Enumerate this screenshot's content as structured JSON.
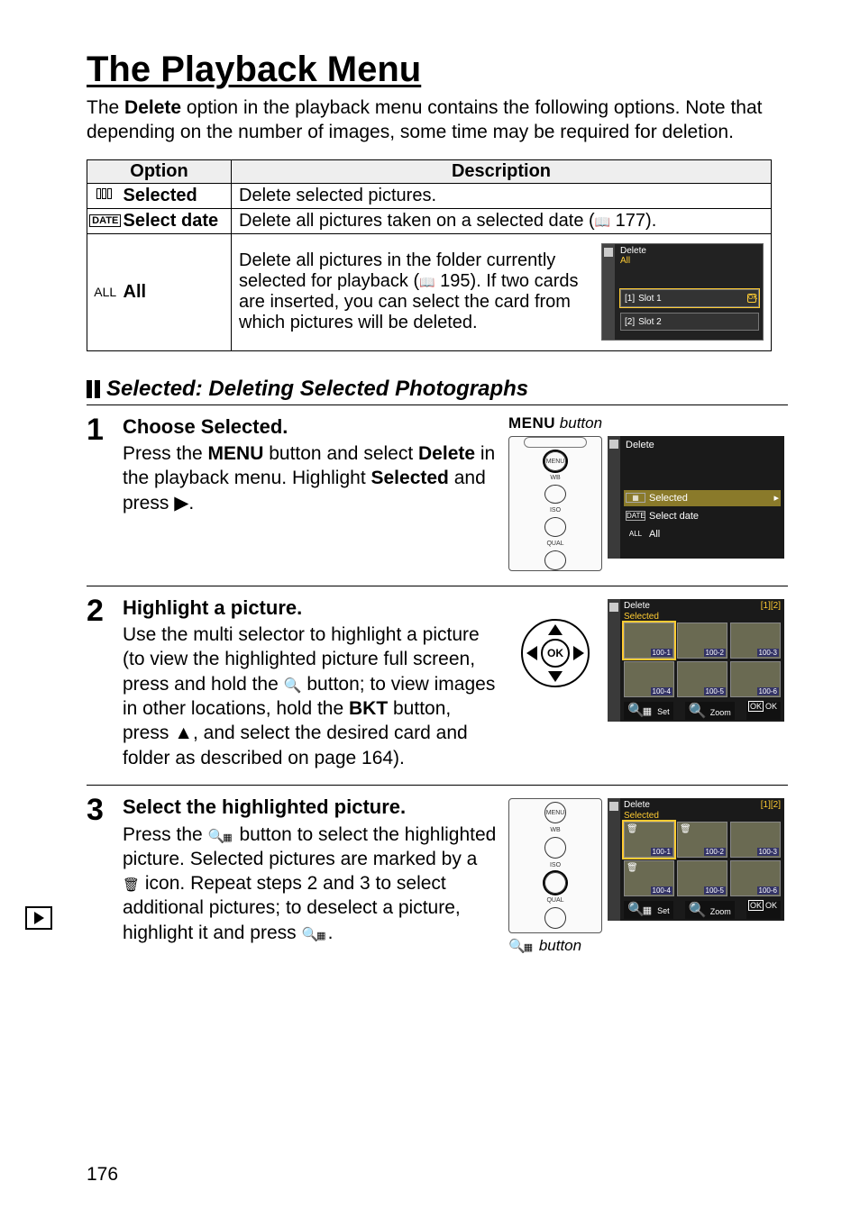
{
  "title": "The Playback Menu",
  "intro_a": "The ",
  "intro_b": "Delete",
  "intro_c": " option in the playback menu contains the following options.  Note that depending on the number of images, some time may be required for deletion.",
  "table": {
    "h_option": "Option",
    "h_desc": "Description",
    "r1_opt": "Selected",
    "r1_desc": "Delete selected pictures.",
    "r2_opt": "Select date",
    "r2_desc_a": "Delete all pictures taken on a selected date (",
    "r2_desc_b": " 177).",
    "r3_icon": "ALL",
    "r3_opt": "All",
    "r3_desc_a": "Delete all pictures in the folder currently selected for playback (",
    "r3_desc_b": " 195). If two cards are inserted, you can select the card from which pictures will be deleted.",
    "date_badge": "DATE"
  },
  "mini": {
    "title": "Delete",
    "sub": "All",
    "slot1": "Slot 1",
    "slot2": "Slot 2",
    "ok": "OK",
    "slot1_ic": "[1]",
    "slot2_ic": "[2]"
  },
  "section": "Selected: Deleting Selected Photographs",
  "step1": {
    "head": "Choose Selected.",
    "a": "Press the ",
    "menu": "MENU",
    "b": " button and select ",
    "del": "Delete",
    "c": " in the playback menu.  Highlight ",
    "sel": "Selected",
    "d": " and press ",
    "tri": "▶",
    "e": ".",
    "cap_a": "MENU",
    "cap_b": " button"
  },
  "menu_shot": {
    "title": "Delete",
    "r1": "Selected",
    "r2": "Select date",
    "r3": "All",
    "r1_ic": "▦",
    "r2_ic": "DATE",
    "r3_ic": "ALL",
    "arr": "▸"
  },
  "step2": {
    "head": "Highlight a picture.",
    "body_a": "Use the multi selector to highlight a picture (to view the highlighted picture full screen, press and hold the ",
    "body_b": " button; to view images in other locations, hold the ",
    "bkt": "BKT",
    "body_c": " button, press ",
    "tri_up": "▲",
    "body_d": ", and select the desired card and folder as described on page 164).",
    "ok": "OK"
  },
  "step3": {
    "head": "Select the highlighted picture.",
    "a": "Press the ",
    "b": " button to select the highlighted picture.  Selected pictures are marked by a ",
    "c": " icon.  Repeat steps 2 and 3 to select additional pictures; to deselect a picture, highlight it and press ",
    "d": ".",
    "cap": " button"
  },
  "thumb": {
    "title": "Delete",
    "sub": "Selected",
    "badge": "[1][2]",
    "cells": [
      "100-1",
      "100-2",
      "100-3",
      "100-4",
      "100-5",
      "100-6"
    ],
    "f_set": "Set",
    "f_zoom": "Zoom",
    "f_ok": "OK"
  },
  "dial": {
    "menu": "MENU",
    "wb": "WB",
    "iso": "ISO",
    "qual": "QUAL"
  },
  "page_no": "176"
}
